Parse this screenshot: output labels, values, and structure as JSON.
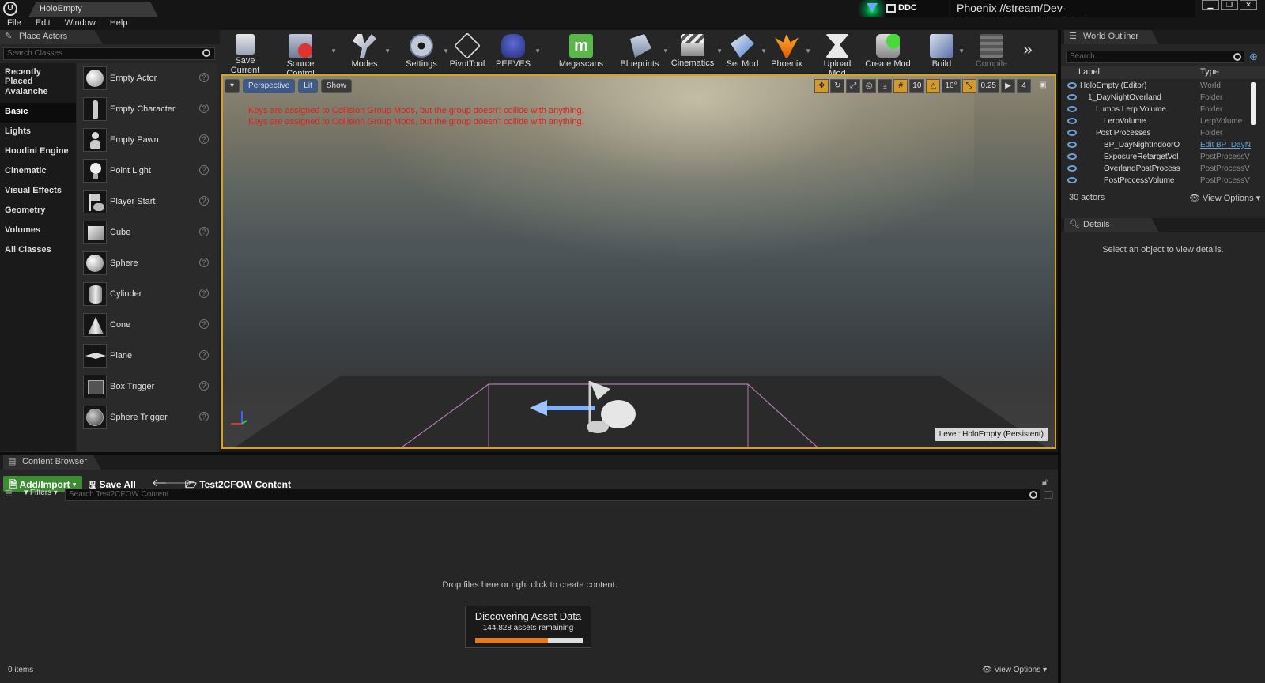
{
  "app": {
    "tab_title": "HoloEmpty",
    "ddc_label": "DDC",
    "branch": "Phoenix //stream/Dev-CreatorKit_TeamCity_Code",
    "logo": "U"
  },
  "menu": [
    "File",
    "Edit",
    "Window",
    "Help"
  ],
  "place_actors": {
    "tab": "Place Actors",
    "search_placeholder": "Search Classes",
    "categories": [
      "Recently Placed",
      "Avalanche",
      "Basic",
      "Lights",
      "Houdini Engine",
      "Cinematic",
      "Visual Effects",
      "Geometry",
      "Volumes",
      "All Classes"
    ],
    "selected_category": "Basic",
    "actors": [
      "Empty Actor",
      "Empty Character",
      "Empty Pawn",
      "Point Light",
      "Player Start",
      "Cube",
      "Sphere",
      "Cylinder",
      "Cone",
      "Plane",
      "Box Trigger",
      "Sphere Trigger"
    ],
    "help_glyph": "?"
  },
  "toolbar": {
    "buttons": [
      "Save Current",
      "Source Control",
      "Modes",
      "Settings",
      "PivotTool",
      "PEEVES",
      "Megascans",
      "Blueprints",
      "Cinematics",
      "Set Mod",
      "Phoenix",
      "Upload Mod",
      "Create Mod",
      "Build",
      "Compile"
    ],
    "overflow": "»"
  },
  "viewport": {
    "view_mode_buttons": [
      "Perspective",
      "Lit",
      "Show"
    ],
    "warnings": [
      "Keys are assigned to Collision Group Mods, but the group doesn't collide with anything.",
      "Keys are assigned to Collision Group Mods, but the group doesn't collide with anything."
    ],
    "grid_snap": "10",
    "rotation_snap": "10°",
    "scale_snap": "0.25",
    "camera_speed": "4",
    "level_label": "Level:  HoloEmpty (Persistent)"
  },
  "outliner": {
    "tab": "World Outliner",
    "search_placeholder": "Search...",
    "columns": [
      "Label",
      "Type"
    ],
    "rows": [
      {
        "name": "HoloEmpty (Editor)",
        "type": "World"
      },
      {
        "name": "1_DayNightOverland",
        "type": "Folder"
      },
      {
        "name": "Lumos Lerp Volume",
        "type": "Folder"
      },
      {
        "name": "LerpVolume",
        "type": "LerpVolume"
      },
      {
        "name": "Post Processes",
        "type": "Folder"
      },
      {
        "name": "BP_DayNightIndoorO",
        "type": "Edit BP_DayN"
      },
      {
        "name": "ExposureRetargetVol",
        "type": "PostProcessV"
      },
      {
        "name": "OverlandPostProcess",
        "type": "PostProcessV"
      },
      {
        "name": "PostProcessVolume",
        "type": "PostProcessV"
      }
    ],
    "actor_count": "30 actors",
    "view_options": "View Options"
  },
  "details": {
    "tab": "Details",
    "empty_msg": "Select an object to view details."
  },
  "content_browser": {
    "tab": "Content Browser",
    "add_import": "Add/Import",
    "save_all": "Save All",
    "path": "Test2CFOW Content",
    "filters": "Filters",
    "search_placeholder": "Search Test2CFOW Content",
    "drop_msg": "Drop files here or right click to create content.",
    "discover_title": "Discovering Asset Data",
    "discover_sub": "144,828 assets remaining",
    "discover_progress": 0.68,
    "item_count": "0 items",
    "view_options": "View Options"
  }
}
